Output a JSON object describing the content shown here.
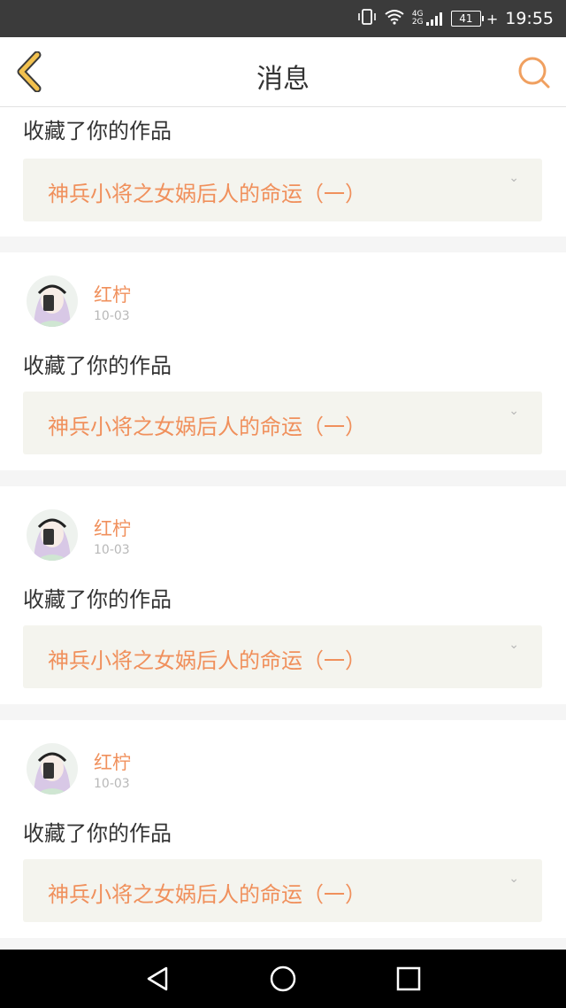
{
  "status_bar": {
    "network": "4G 2G",
    "battery": "41",
    "time": "19:55"
  },
  "header": {
    "title": "消息",
    "back_icon": "chevron-left-icon",
    "search_icon": "search-icon",
    "accent_color": "#f0a060"
  },
  "notifications": [
    {
      "username": "",
      "date": "",
      "action": "收藏了你的作品",
      "work_title": "神兵小将之女娲后人的命运（一）",
      "partial": true
    },
    {
      "username": "红柠",
      "date": "10-03",
      "action": "收藏了你的作品",
      "work_title": "神兵小将之女娲后人的命运（一）"
    },
    {
      "username": "红柠",
      "date": "10-03",
      "action": "收藏了你的作品",
      "work_title": "神兵小将之女娲后人的命运（一）"
    },
    {
      "username": "红柠",
      "date": "10-03",
      "action": "收藏了你的作品",
      "work_title": "神兵小将之女娲后人的命运（一）"
    }
  ],
  "nav": {
    "back": "triangle-back-icon",
    "home": "circle-home-icon",
    "recents": "square-recents-icon"
  }
}
